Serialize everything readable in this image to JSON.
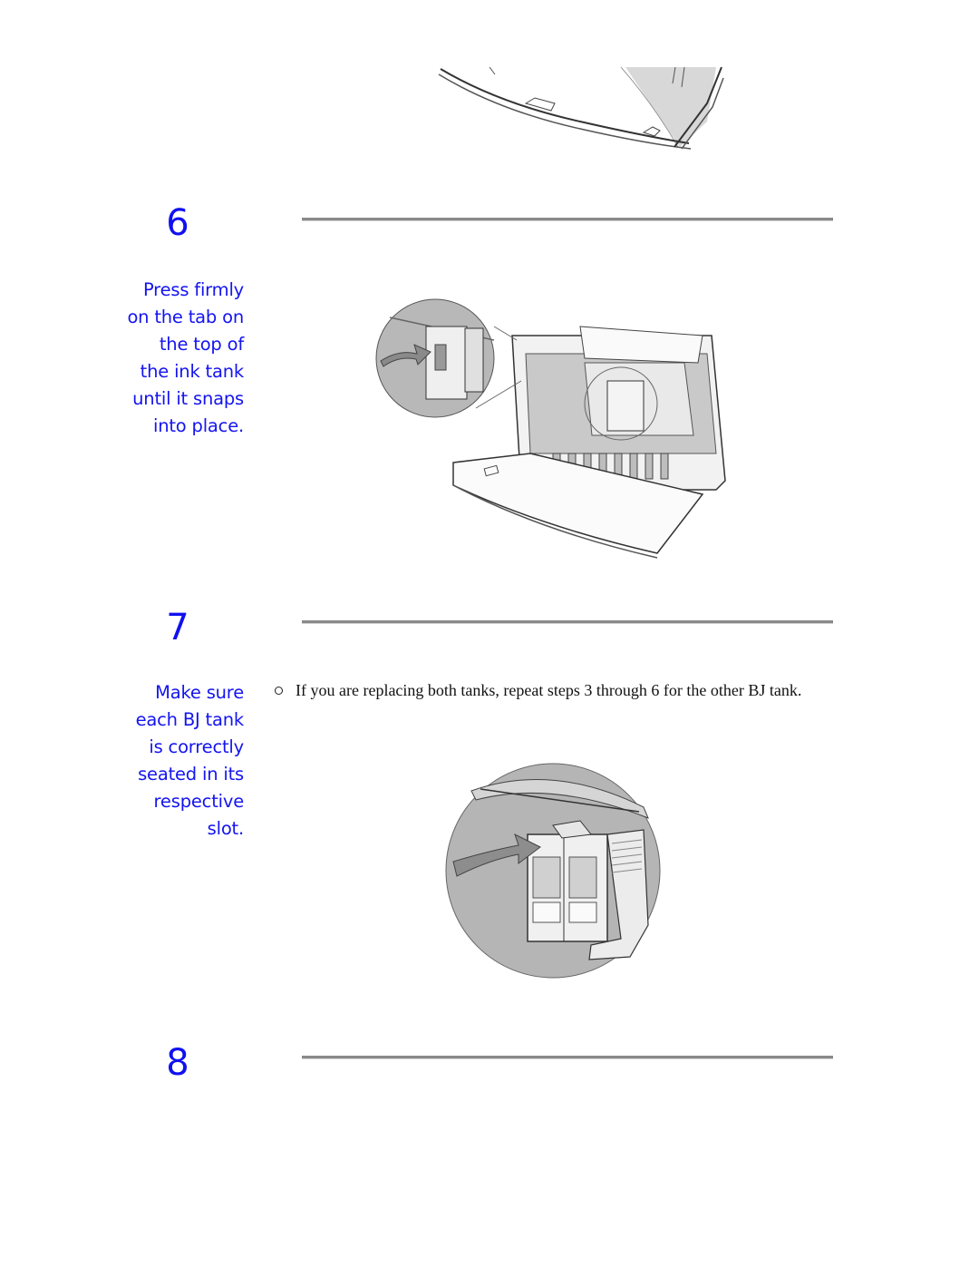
{
  "steps": [
    {
      "number": "6",
      "caption_lines": [
        "Press firmly",
        "on the tab on",
        "the top of",
        "the ink tank",
        "until it snaps",
        "into place."
      ]
    },
    {
      "number": "7",
      "caption_lines": [
        "Make sure",
        "each BJ tank",
        "is correctly",
        "seated in its",
        "respective",
        "slot."
      ],
      "bullet_text": "If you are replacing both tanks, repeat steps 3 through 6 for the other BJ tank."
    },
    {
      "number": "8"
    }
  ],
  "illustrations": {
    "top_partial": "printer-paper-tray-illustration",
    "step6": "printer-with-ink-tank-inset-illustration",
    "step7": "bj-tank-closeup-illustration"
  }
}
